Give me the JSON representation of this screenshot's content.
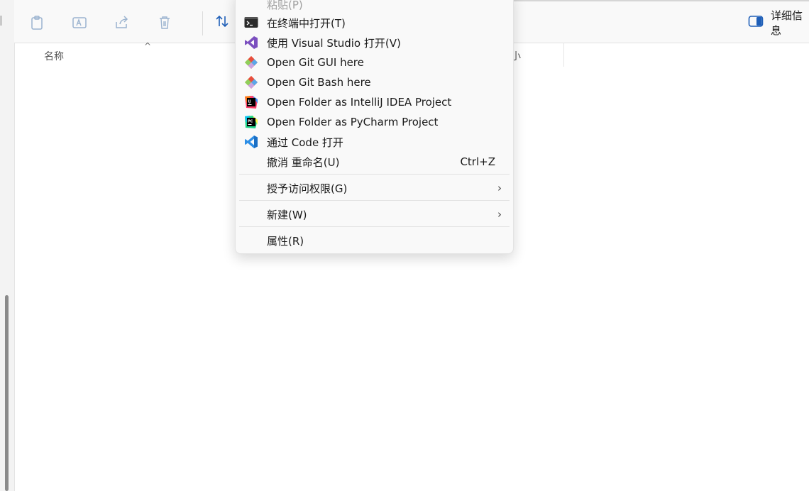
{
  "toolbar": {
    "sort_label": "排",
    "details_label": "详细信息"
  },
  "columns": {
    "name": "名称",
    "size": "小"
  },
  "menu": {
    "paste": "粘贴(P)",
    "items": [
      {
        "label": "在终端中打开(T)",
        "icon": "terminal-icon"
      },
      {
        "label": "使用 Visual Studio 打开(V)",
        "icon": "visual-studio-icon"
      },
      {
        "label": "Open Git GUI here",
        "icon": "git-icon"
      },
      {
        "label": "Open Git Bash here",
        "icon": "git-icon"
      },
      {
        "label": "Open Folder as IntelliJ IDEA Project",
        "icon": "intellij-icon"
      },
      {
        "label": "Open Folder as PyCharm Project",
        "icon": "pycharm-icon"
      },
      {
        "label": "通过 Code 打开",
        "icon": "vscode-icon"
      },
      {
        "label": "撤消 重命名(U)",
        "shortcut": "Ctrl+Z"
      },
      {
        "label": "授予访问权限(G)",
        "submenu": true
      },
      {
        "label": "新建(W)",
        "submenu": true
      },
      {
        "label": "属性(R)"
      }
    ]
  },
  "colors": {
    "accent_blue": "#1f5fb8",
    "vs_purple": "#7b4fbf",
    "vscode_blue": "#2d8ee6",
    "pycharm_green": "#21d789",
    "intellij_pink": "#fc3e6a"
  }
}
